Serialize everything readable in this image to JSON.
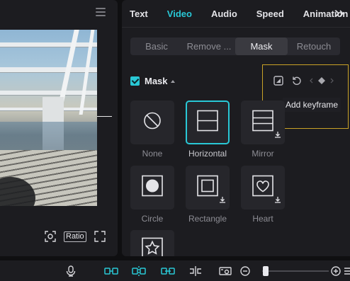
{
  "preview": {
    "ratio_label": "Ratio",
    "icons": [
      "menu-icon",
      "fit-screen-icon",
      "fullscreen-icon"
    ]
  },
  "tabs": [
    {
      "label": "Text",
      "active": false
    },
    {
      "label": "Video",
      "active": true
    },
    {
      "label": "Audio",
      "active": false
    },
    {
      "label": "Speed",
      "active": false
    },
    {
      "label": "Animation",
      "active": false
    }
  ],
  "subtabs": [
    {
      "label": "Basic",
      "active": false
    },
    {
      "label": "Remove ...",
      "active": false
    },
    {
      "label": "Mask",
      "active": true
    },
    {
      "label": "Retouch",
      "active": false
    }
  ],
  "mask": {
    "title": "Mask",
    "enabled": true,
    "tooltip": "Add keyframe",
    "items": [
      {
        "label": "None",
        "icon": "none-icon",
        "selected": false,
        "download": false
      },
      {
        "label": "Horizontal",
        "icon": "horizontal-mask-icon",
        "selected": true,
        "download": false
      },
      {
        "label": "Mirror",
        "icon": "mirror-mask-icon",
        "selected": false,
        "download": true
      },
      {
        "label": "Circle",
        "icon": "circle-mask-icon",
        "selected": false,
        "download": false
      },
      {
        "label": "Rectangle",
        "icon": "rectangle-mask-icon",
        "selected": false,
        "download": true
      },
      {
        "label": "Heart",
        "icon": "heart-mask-icon",
        "selected": false,
        "download": true
      },
      {
        "label": "",
        "icon": "star-mask-icon",
        "selected": false,
        "download": false
      }
    ]
  },
  "colors": {
    "accent": "#29c8d6",
    "highlight": "#c9a227",
    "panel": "#1c1c20",
    "background": "#0f0f11"
  },
  "toolbar": {
    "zoom_level": 0.05
  }
}
